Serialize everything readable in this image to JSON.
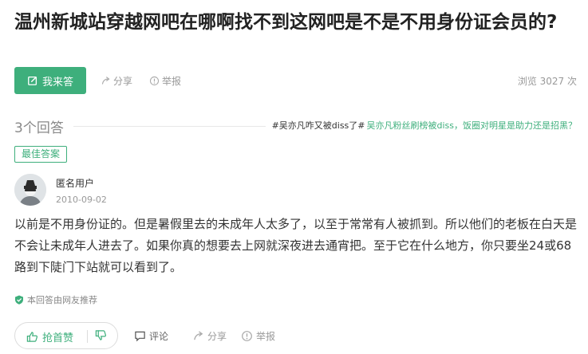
{
  "question": {
    "title": "温州新城站穿越网吧在哪啊找不到这网吧是不是不用身份证会员的?"
  },
  "toolbar": {
    "answer_label": "我来答",
    "share_label": "分享",
    "report_label": "举报",
    "views": "浏览 3027 次"
  },
  "answers_header": {
    "count": "3个回答",
    "trend_1": "#吴亦凡咋又被diss了#",
    "trend_2": "吴亦凡粉丝刷榜被diss，饭圈对明星是助力还是招黑？"
  },
  "answer": {
    "badge": "最佳答案",
    "user": "匿名用户",
    "date": "2010-09-02",
    "body": "以前是不用身份证的。但是暑假里去的未成年人太多了，以至于常常有人被抓到。所以他们的老板在白天是不会让未成年人进去了。如果你真的想要去上网就深夜进去通宵把。至于它在什么地方，你只要坐24或68路到下陡门下站就可以看到了。",
    "recommend": "本回答由网友推荐"
  },
  "footer": {
    "upvote_label": "抢首赞",
    "comment_label": "评论",
    "share_label": "分享",
    "report_label": "举报"
  },
  "colors": {
    "accent": "#3eaf7c",
    "muted": "#999999",
    "text": "#333333"
  },
  "icons": {
    "answer": "edit-icon",
    "share": "share-icon",
    "report": "report-icon",
    "recommend": "shield-check-icon",
    "upvote": "thumbs-up-icon",
    "downvote": "thumbs-down-icon",
    "comment": "comment-icon"
  }
}
